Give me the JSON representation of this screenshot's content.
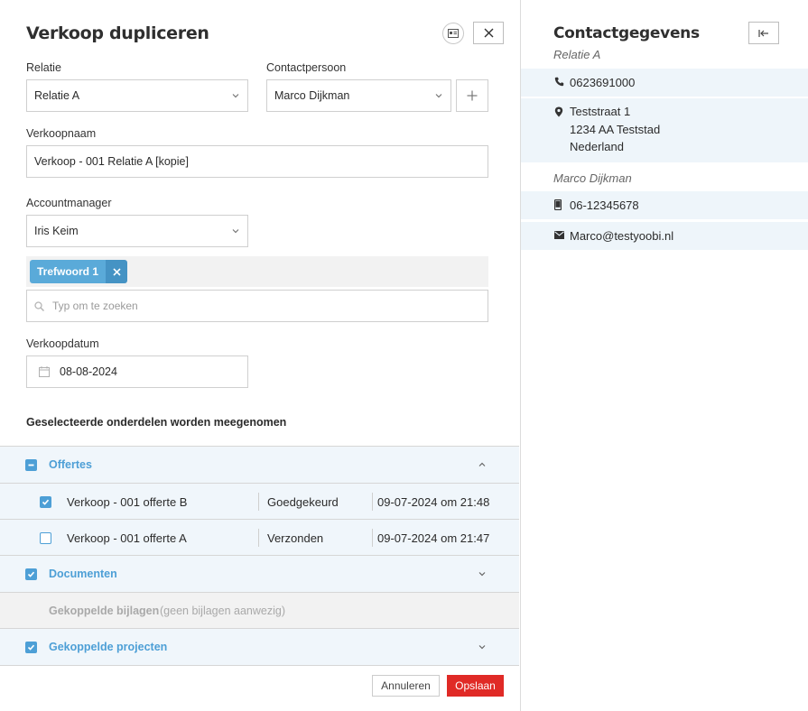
{
  "dialog": {
    "title": "Verkoop dupliceren",
    "relatie": {
      "label": "Relatie",
      "value": "Relatie A"
    },
    "contactpersoon": {
      "label": "Contactpersoon",
      "value": "Marco Dijkman"
    },
    "verkoopnaam": {
      "label": "Verkoopnaam",
      "value": "Verkoop - 001 Relatie A [kopie]"
    },
    "accountmanager": {
      "label": "Accountmanager",
      "value": "Iris Keim"
    },
    "tags": [
      {
        "label": "Trefwoord 1"
      }
    ],
    "search": {
      "placeholder": "Typ om te zoeken"
    },
    "verkoopdatum": {
      "label": "Verkoopdatum",
      "value": "08-08-2024"
    },
    "section_heading": "Geselecteerde onderdelen worden meegenomen",
    "sections": {
      "offertes": {
        "label": "Offertes",
        "state": "indeterminate",
        "expanded": true,
        "items": [
          {
            "name": "Verkoop - 001 offerte B",
            "status": "Goedgekeurd",
            "date": "09-07-2024 om 21:48",
            "checked": true
          },
          {
            "name": "Verkoop - 001 offerte A",
            "status": "Verzonden",
            "date": "09-07-2024 om 21:47",
            "checked": false
          }
        ]
      },
      "documenten": {
        "label": "Documenten",
        "checked": true
      },
      "bijlagen": {
        "label": "Gekoppelde bijlagen",
        "note": "(geen bijlagen aanwezig)"
      },
      "projecten": {
        "label": "Gekoppelde projecten",
        "checked": true
      }
    },
    "buttons": {
      "cancel": "Annuleren",
      "save": "Opslaan"
    }
  },
  "contact_panel": {
    "title": "Contactgegevens",
    "relation_name": "Relatie A",
    "phone": "0623691000",
    "address": {
      "street": "Teststraat 1",
      "city": "1234 AA Teststad",
      "country": "Nederland"
    },
    "person_name": "Marco Dijkman",
    "mobile": "06-12345678",
    "email": "Marco@testyoobi.nl"
  },
  "colors": {
    "accent": "#4d9fd6",
    "save": "#e02a26",
    "tag": "#5aaad9",
    "panel_row": "#eef5fa"
  },
  "icons": [
    "id-card-icon",
    "close-icon",
    "chevron-down-icon",
    "plus-icon",
    "search-icon",
    "calendar-icon",
    "chevron-up-icon",
    "collapse-panel-icon",
    "phone-icon",
    "location-icon",
    "mobile-icon",
    "mail-icon"
  ]
}
